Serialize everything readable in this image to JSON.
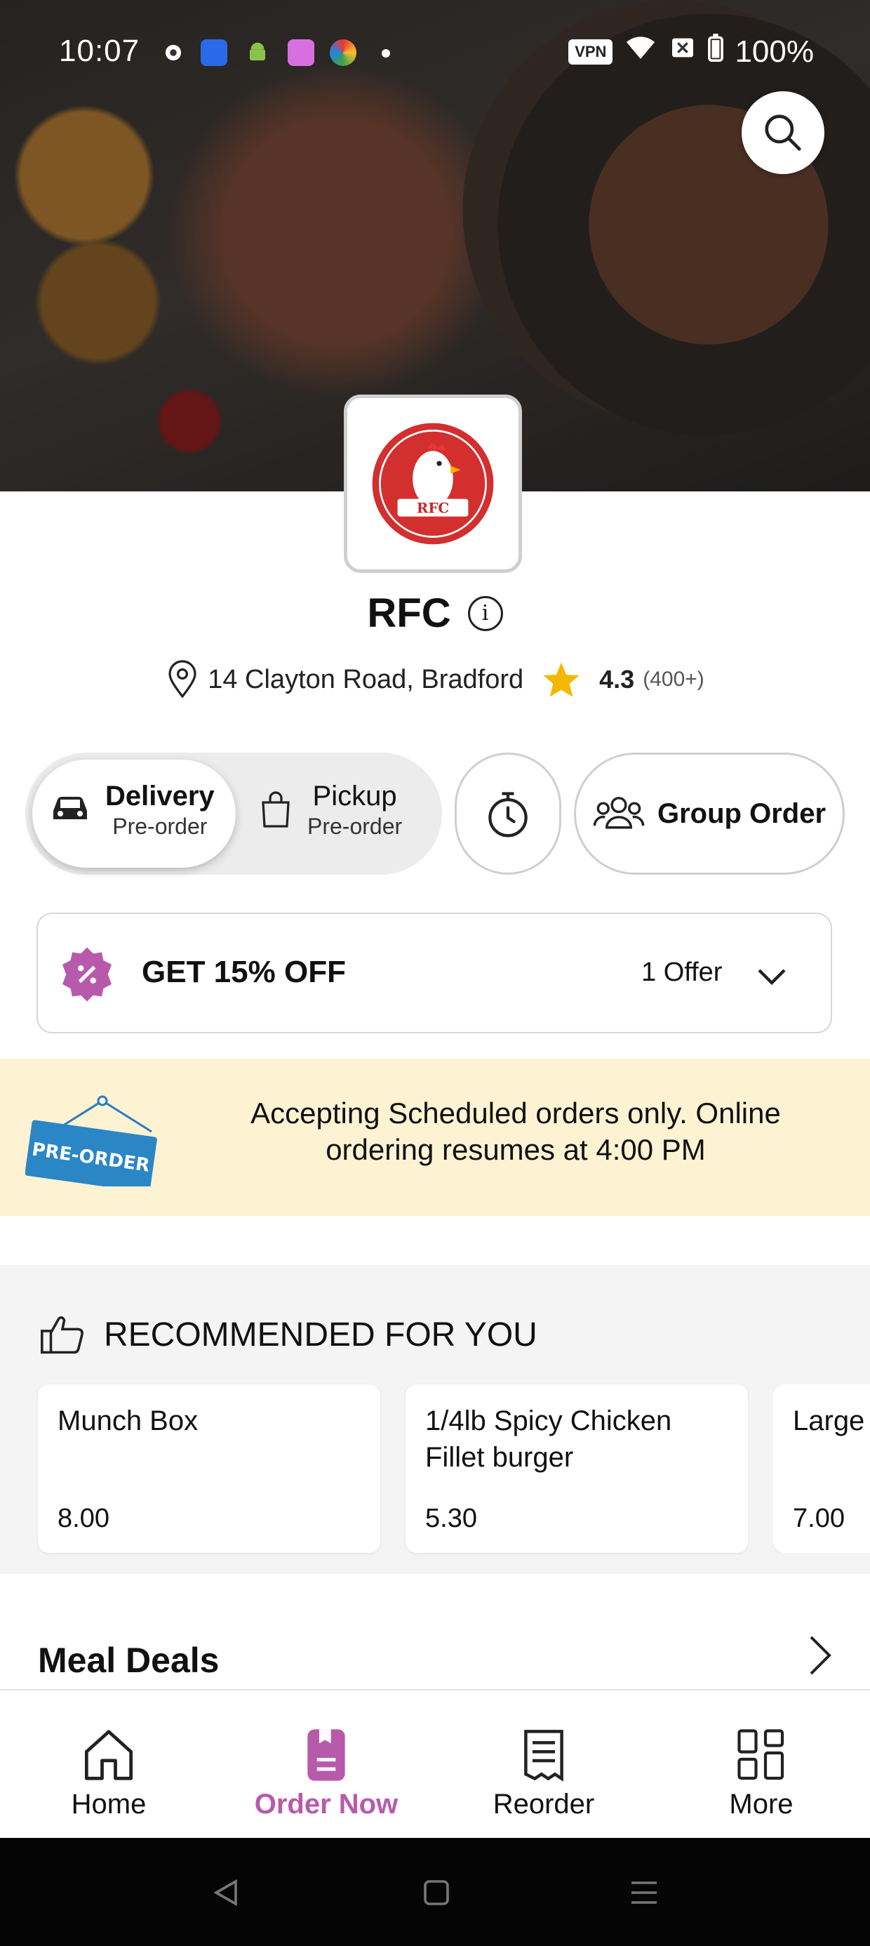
{
  "status_bar": {
    "time": "10:07",
    "vpn": "VPN",
    "battery": "100%"
  },
  "store": {
    "name": "RFC",
    "logo_text": "RFC",
    "address": "14 Clayton Road, Bradford",
    "rating": "4.3",
    "rating_count": "(400+)"
  },
  "modes": {
    "delivery": {
      "title": "Delivery",
      "sub": "Pre-order"
    },
    "pickup": {
      "title": "Pickup",
      "sub": "Pre-order"
    },
    "group_order": "Group Order"
  },
  "offer": {
    "title": "GET 15% OFF",
    "count": "1 Offer"
  },
  "banner": {
    "sign": "PRE-ORDER",
    "text": "Accepting Scheduled orders only. Online ordering resumes at 4:00 PM"
  },
  "recommended": {
    "heading": "RECOMMENDED FOR YOU",
    "items": [
      {
        "name": "Munch Box",
        "price": "8.00"
      },
      {
        "name": "1/4lb Spicy Chicken Fillet burger",
        "price": "5.30"
      },
      {
        "name": "Large Chips",
        "price": "7.00"
      }
    ]
  },
  "section_title": "Meal Deals",
  "nav": {
    "home": "Home",
    "order_now": "Order Now",
    "reorder": "Reorder",
    "more": "More"
  },
  "colors": {
    "accent": "#b85aac",
    "banner_bg": "#fdf3d3",
    "star": "#f5b800"
  }
}
